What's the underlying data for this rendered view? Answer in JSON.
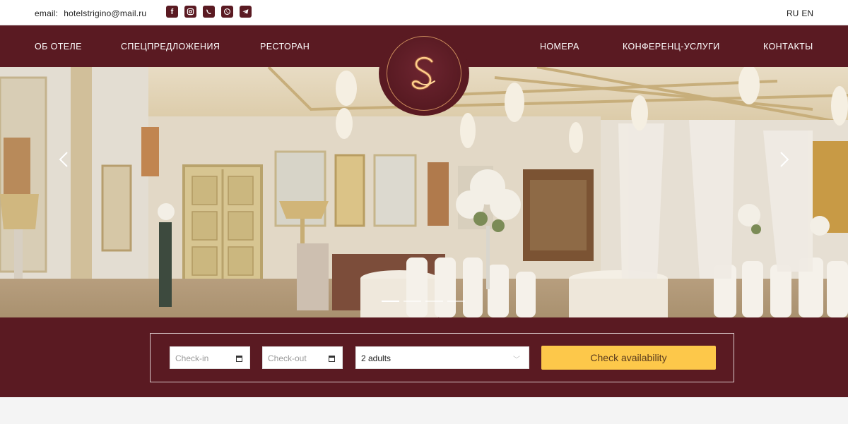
{
  "topbar": {
    "email_label": "email:",
    "email_address": "hotelstrigino@mail.ru",
    "socials": [
      {
        "icon": "facebook-icon",
        "glyph": "f"
      },
      {
        "icon": "instagram-icon",
        "glyph": ""
      },
      {
        "icon": "viber-icon",
        "glyph": ""
      },
      {
        "icon": "whatsapp-icon",
        "glyph": ""
      },
      {
        "icon": "telegram-icon",
        "glyph": ""
      }
    ],
    "lang_ru": "RU",
    "lang_en": "EN"
  },
  "nav": {
    "about": "ОБ ОТЕЛЕ",
    "offers": "СПЕЦПРЕДЛОЖЕНИЯ",
    "restaurant": "РЕСТОРАН",
    "rooms": "НОМЕРА",
    "conference": "КОНФЕРЕНЦ-УСЛУГИ",
    "contacts": "КОНТАКТЫ"
  },
  "logo": {
    "letter": "S"
  },
  "slider": {
    "slides": 4,
    "active_slide": 1
  },
  "booking": {
    "checkin_placeholder": "Check-in",
    "checkout_placeholder": "Check-out",
    "guests_value": "2 adults",
    "button_label": "Check availability"
  },
  "colors": {
    "brand": "#5a1a22",
    "accent": "#fdc84a"
  }
}
